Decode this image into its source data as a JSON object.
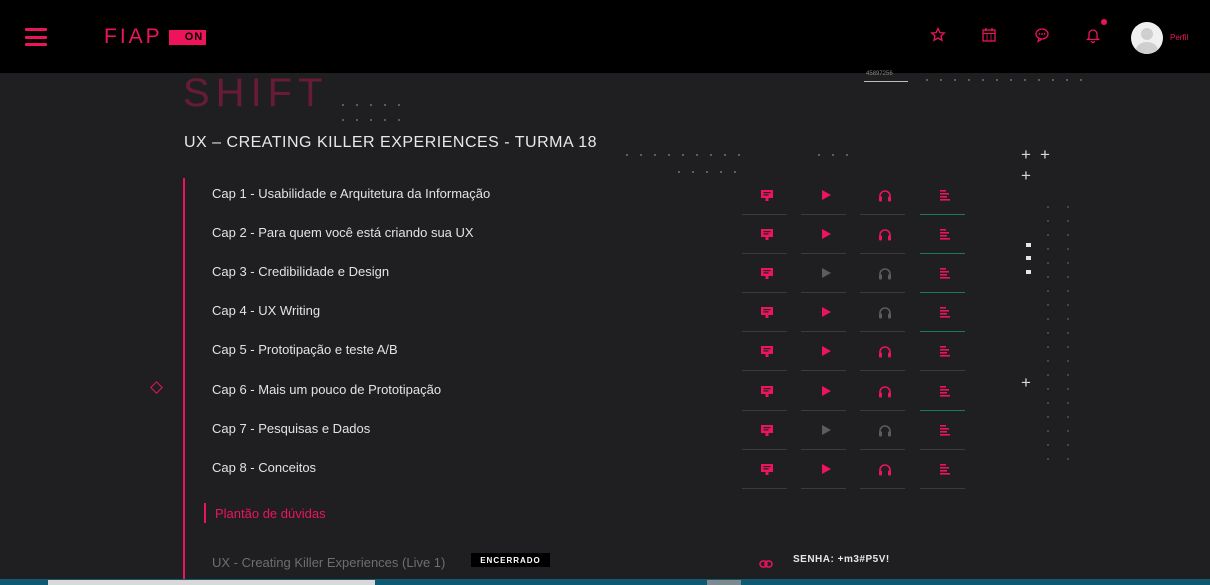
{
  "brand": {
    "logo_text": "FIAP",
    "logo_badge": "ON"
  },
  "header": {
    "icons": [
      "menu-icon",
      "star-icon",
      "calendar-icon",
      "chat-icon",
      "bell-icon"
    ],
    "profile_label": "Perfil",
    "notification": true
  },
  "page": {
    "section_title": "SHIFT",
    "id_code": "45897256",
    "course_title": "UX – CREATING KILLER EXPERIENCES - TURMA 18"
  },
  "chapters": [
    {
      "label": "Cap 1 - Usabilidade e Arquitetura da Informação",
      "active": [
        true,
        true,
        true,
        true
      ],
      "progress": [
        0,
        0,
        0,
        1
      ]
    },
    {
      "label": "Cap 2 - Para quem você está criando sua UX",
      "active": [
        true,
        true,
        true,
        true
      ],
      "progress": [
        0,
        0,
        0,
        1
      ]
    },
    {
      "label": "Cap 3 - Credibilidade e Design",
      "active": [
        true,
        false,
        false,
        true
      ],
      "progress": [
        0,
        0,
        0,
        1
      ]
    },
    {
      "label": "Cap 4 - UX Writing",
      "active": [
        true,
        true,
        false,
        true
      ],
      "progress": [
        0,
        0,
        0,
        1
      ]
    },
    {
      "label": "Cap 5 - Prototipação e teste A/B",
      "active": [
        true,
        true,
        true,
        true
      ],
      "progress": [
        0,
        0,
        0,
        0
      ]
    },
    {
      "label": "Cap 6 - Mais um pouco de Prototipação",
      "active": [
        true,
        true,
        true,
        true
      ],
      "progress": [
        0,
        0,
        0,
        1
      ]
    },
    {
      "label": "Cap 7 - Pesquisas e Dados",
      "active": [
        true,
        false,
        false,
        true
      ],
      "progress": [
        0,
        0,
        0,
        0
      ]
    },
    {
      "label": "Cap 8 - Conceitos",
      "active": [
        true,
        true,
        true,
        true
      ],
      "progress": [
        0,
        0,
        0,
        0
      ]
    }
  ],
  "chapter_icons": [
    "slides-icon",
    "play-icon",
    "headphones-icon",
    "text-icon"
  ],
  "current_chapter": 6,
  "plantao": {
    "label": "Plantão de dúvidas"
  },
  "live": {
    "title": "UX - Creating Killer Experiences (Live 1)",
    "status": "ENCERRADO",
    "password": "SENHA: +m3#P5V!"
  },
  "colors": {
    "accent": "#ed145b",
    "background": "#1f1f21",
    "header": "#000000",
    "inactive": "#5c5c5c",
    "progress_green": "#1d7b54"
  }
}
